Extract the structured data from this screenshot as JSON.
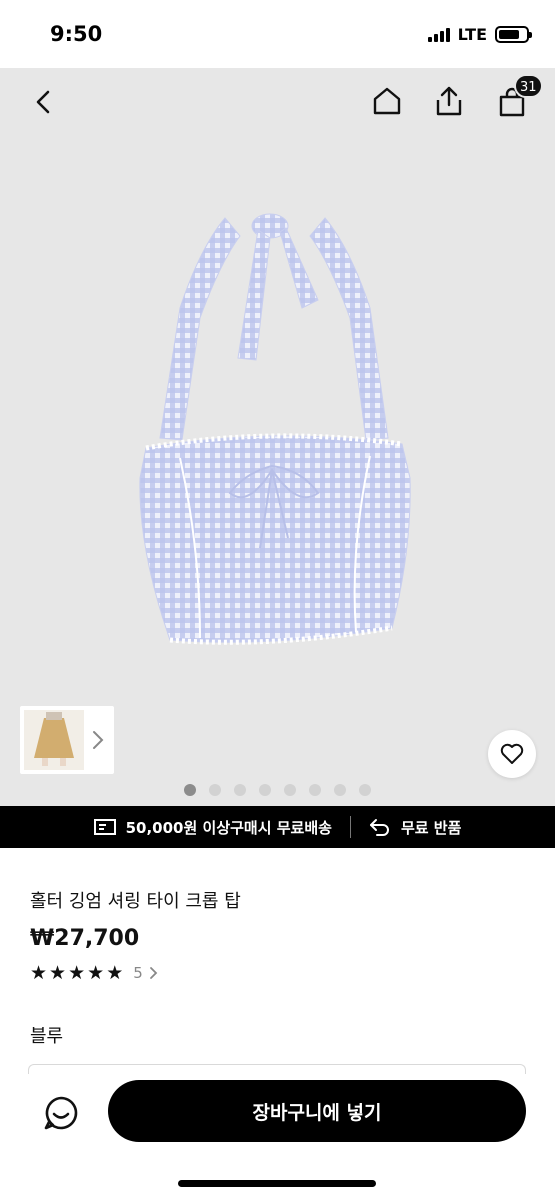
{
  "status": {
    "time": "9:50",
    "network": "LTE",
    "battery_level": 0.75
  },
  "nav": {
    "icons": [
      "back-icon",
      "home-icon",
      "share-icon",
      "cart-icon"
    ],
    "cart_count": "31"
  },
  "gallery": {
    "dots_total": 8,
    "active_index": 0,
    "thumbnail_icon": "chevron-right-icon",
    "wishlist_icon": "heart-icon"
  },
  "promo": {
    "shipping": "50,000원 이상구매시 무료배송",
    "returns": "무료 반품"
  },
  "product": {
    "title": "홀터 깅엄 셔링 타이 크롭 탑",
    "price": "₩27,700",
    "rating_stars": 5,
    "review_count": "5",
    "color_label": "블루"
  },
  "bottom": {
    "add_to_cart": "장바구니에 넣기",
    "chat_icon": "chat-icon"
  },
  "colors": {
    "hero_bg": "#e7e7e7",
    "gingham": "#b9c1ea",
    "black": "#000000"
  }
}
